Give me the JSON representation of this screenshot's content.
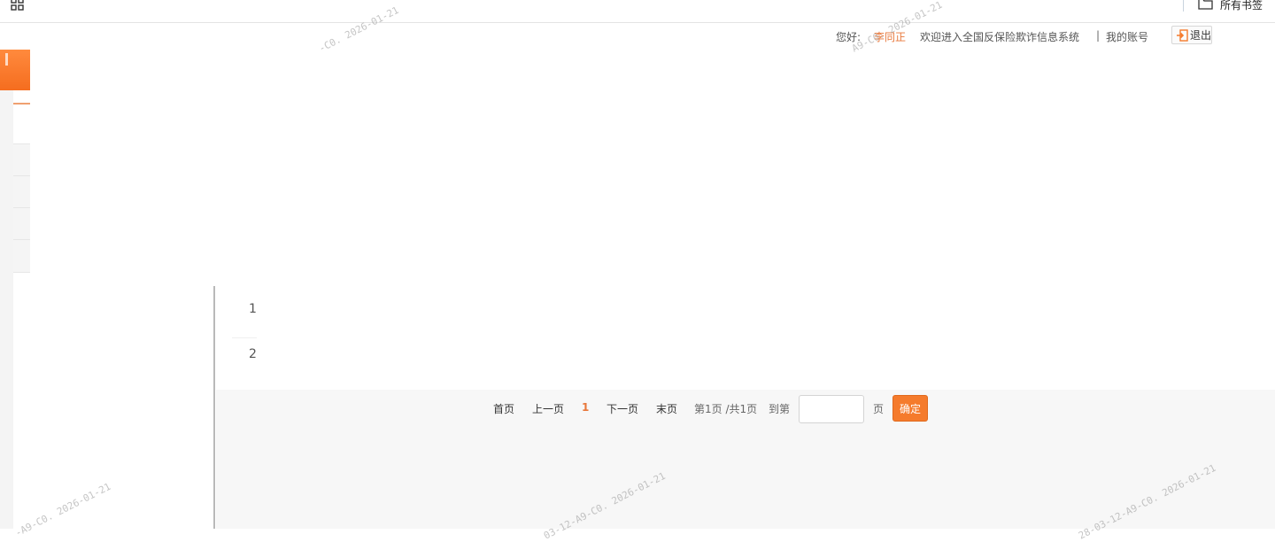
{
  "bookmarks_bar": {
    "apps_icon": "apps-grid-icon",
    "folder_icon": "folder-icon",
    "all_bookmarks_label": "所有书签"
  },
  "header": {
    "greeting": "您好:",
    "username": "李同正",
    "welcome": "欢迎进入全国反保险欺诈信息系统",
    "separator": "|",
    "my_account": "我的账号",
    "logout_label": "退出",
    "logout_icon": "logout-icon"
  },
  "table": {
    "row_numbers": [
      "1",
      "2"
    ]
  },
  "pagination": {
    "first": "首页",
    "prev": "上一页",
    "current": "1",
    "next": "下一页",
    "last": "末页",
    "info": "第1页 /共1页",
    "goto_prefix": "到第",
    "goto_value": "",
    "goto_suffix": "页",
    "confirm": "确定"
  },
  "watermarks": [
    "-C0. 2026-01-21",
    "A9-C0. 2026-01-21",
    "-A9-C0. 2026-01-21",
    "03-12-A9-C0. 2026-01-21",
    "28-03-12-A9-C0. 2026-01-21"
  ],
  "colors": {
    "accent": "#f57b2c",
    "username": "#e8773a",
    "content_bg": "#f7f7f7"
  }
}
